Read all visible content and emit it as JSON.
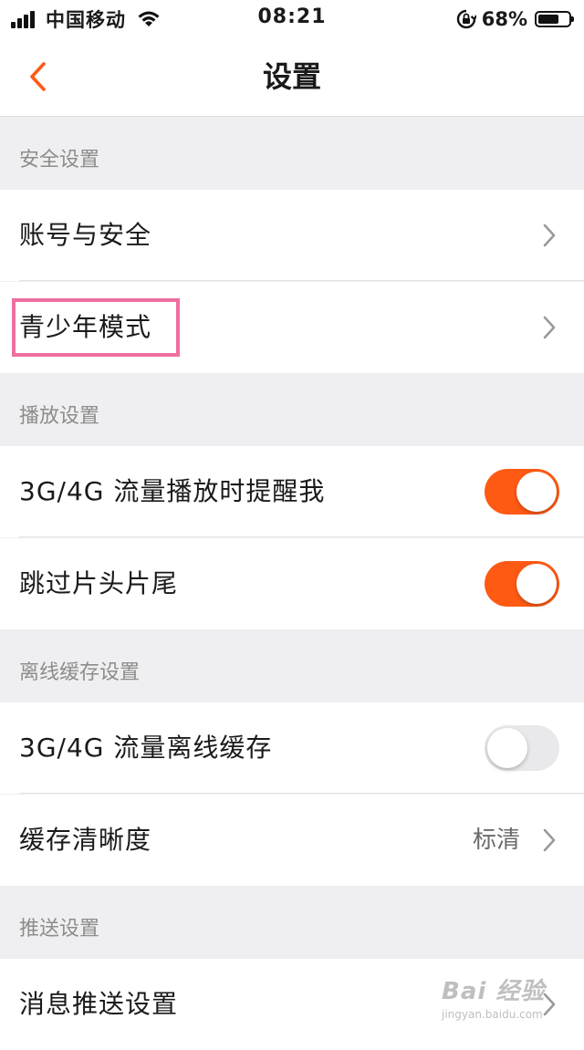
{
  "status_bar": {
    "carrier": "中国移动",
    "time": "08:21",
    "battery": "68%",
    "battery_level": 0.68
  },
  "nav": {
    "title": "设置",
    "back_icon": "chevron-left-icon",
    "accent_color": "#ff5a14"
  },
  "sections": {
    "security": {
      "header": "安全设置",
      "account_security": {
        "label": "账号与安全"
      },
      "youth_mode": {
        "label": "青少年模式"
      }
    },
    "playback": {
      "header": "播放设置",
      "cellular_play_reminder": {
        "label": "3G/4G 流量播放时提醒我",
        "enabled": true
      },
      "skip_intro_outro": {
        "label": "跳过片头片尾",
        "enabled": true
      }
    },
    "offline_cache": {
      "header": "离线缓存设置",
      "cellular_offline_cache": {
        "label": "3G/4G 流量离线缓存",
        "enabled": false
      },
      "cache_quality": {
        "label": "缓存清晰度",
        "value": "标清"
      }
    },
    "push": {
      "header": "推送设置",
      "message_push": {
        "label": "消息推送设置"
      }
    }
  },
  "colors": {
    "toggle_on": "#ff5a14",
    "toggle_off": "#e9e9eb",
    "highlight": "#ef6ea0"
  },
  "watermark": {
    "logo": "Bai 经验",
    "url": "jingyan.baidu.com"
  }
}
